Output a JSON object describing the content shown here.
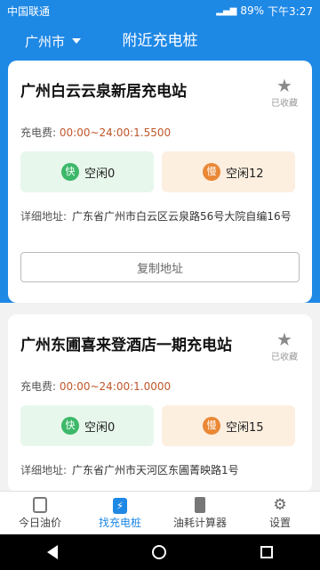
{
  "status_bar": {
    "carrier": "中国联通",
    "battery": "89%",
    "time": "下午3:27"
  },
  "header": {
    "city": "广州市",
    "title": "附近充电桩"
  },
  "stations": [
    {
      "name": "广州白云云泉新居充电站",
      "favorite_label": "已收藏",
      "fee_label": "充电费:",
      "fee_value": "00:00~24:00:1.5500",
      "fast_badge": "快",
      "fast_text": "空闲0",
      "slow_badge": "慢",
      "slow_text": "空闲12",
      "address_label": "详细地址:",
      "address": "广东省广州市白云区云泉路56号大院自编16号",
      "copy_button": "复制地址"
    },
    {
      "name": "广州东圃喜来登酒店一期充电站",
      "favorite_label": "已收藏",
      "fee_label": "充电费:",
      "fee_value": "00:00~24:00:1.0000",
      "fast_badge": "快",
      "fast_text": "空闲0",
      "slow_badge": "慢",
      "slow_text": "空闲15",
      "address_label": "详细地址:",
      "address": "广东省广州市天河区东圃菁映路1号"
    }
  ],
  "tabs": [
    {
      "label": "今日油价",
      "icon": "document-icon"
    },
    {
      "label": "找充电桩",
      "icon": "charging-icon",
      "active": true
    },
    {
      "label": "油耗计算器",
      "icon": "phone-icon"
    },
    {
      "label": "设置",
      "icon": "gear-icon"
    }
  ],
  "colors": {
    "primary": "#1e88e5",
    "fast": "#3cb869",
    "slow": "#ea8836",
    "fee": "#c0562a"
  }
}
